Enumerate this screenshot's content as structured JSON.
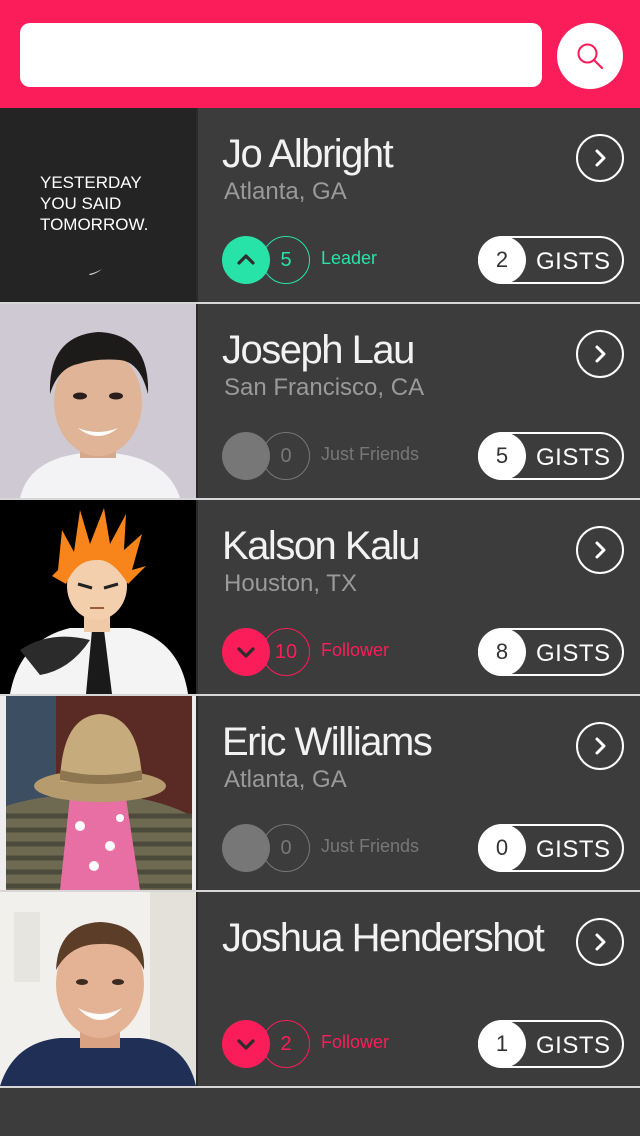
{
  "search": {
    "placeholder": "",
    "value": ""
  },
  "gists_label": "GISTS",
  "colors": {
    "accent": "#fa1d5a",
    "leader": "#28e3a8",
    "neutral": "#777777",
    "background": "#3c3c3c"
  },
  "profiles": [
    {
      "name": "Jo Albright",
      "location": "Atlanta, GA",
      "relationship": {
        "type": "leader",
        "icon": "chevron-up-icon",
        "count": "5",
        "label": "Leader"
      },
      "gists": "2",
      "photo_caption": [
        "YESTERDAY",
        "YOU SAID",
        "TOMORROW."
      ]
    },
    {
      "name": "Joseph Lau",
      "location": "San Francisco, CA",
      "relationship": {
        "type": "friends",
        "icon": "none",
        "count": "0",
        "label": "Just Friends"
      },
      "gists": "5"
    },
    {
      "name": "Kalson Kalu",
      "location": "Houston, TX",
      "relationship": {
        "type": "follower",
        "icon": "chevron-down-icon",
        "count": "10",
        "label": "Follower"
      },
      "gists": "8"
    },
    {
      "name": "Eric Williams",
      "location": "Atlanta, GA",
      "relationship": {
        "type": "friends",
        "icon": "none",
        "count": "0",
        "label": "Just Friends"
      },
      "gists": "0"
    },
    {
      "name": "Joshua Hendershot",
      "location": "",
      "relationship": {
        "type": "follower",
        "icon": "chevron-down-icon",
        "count": "2",
        "label": "Follower"
      },
      "gists": "1"
    }
  ]
}
